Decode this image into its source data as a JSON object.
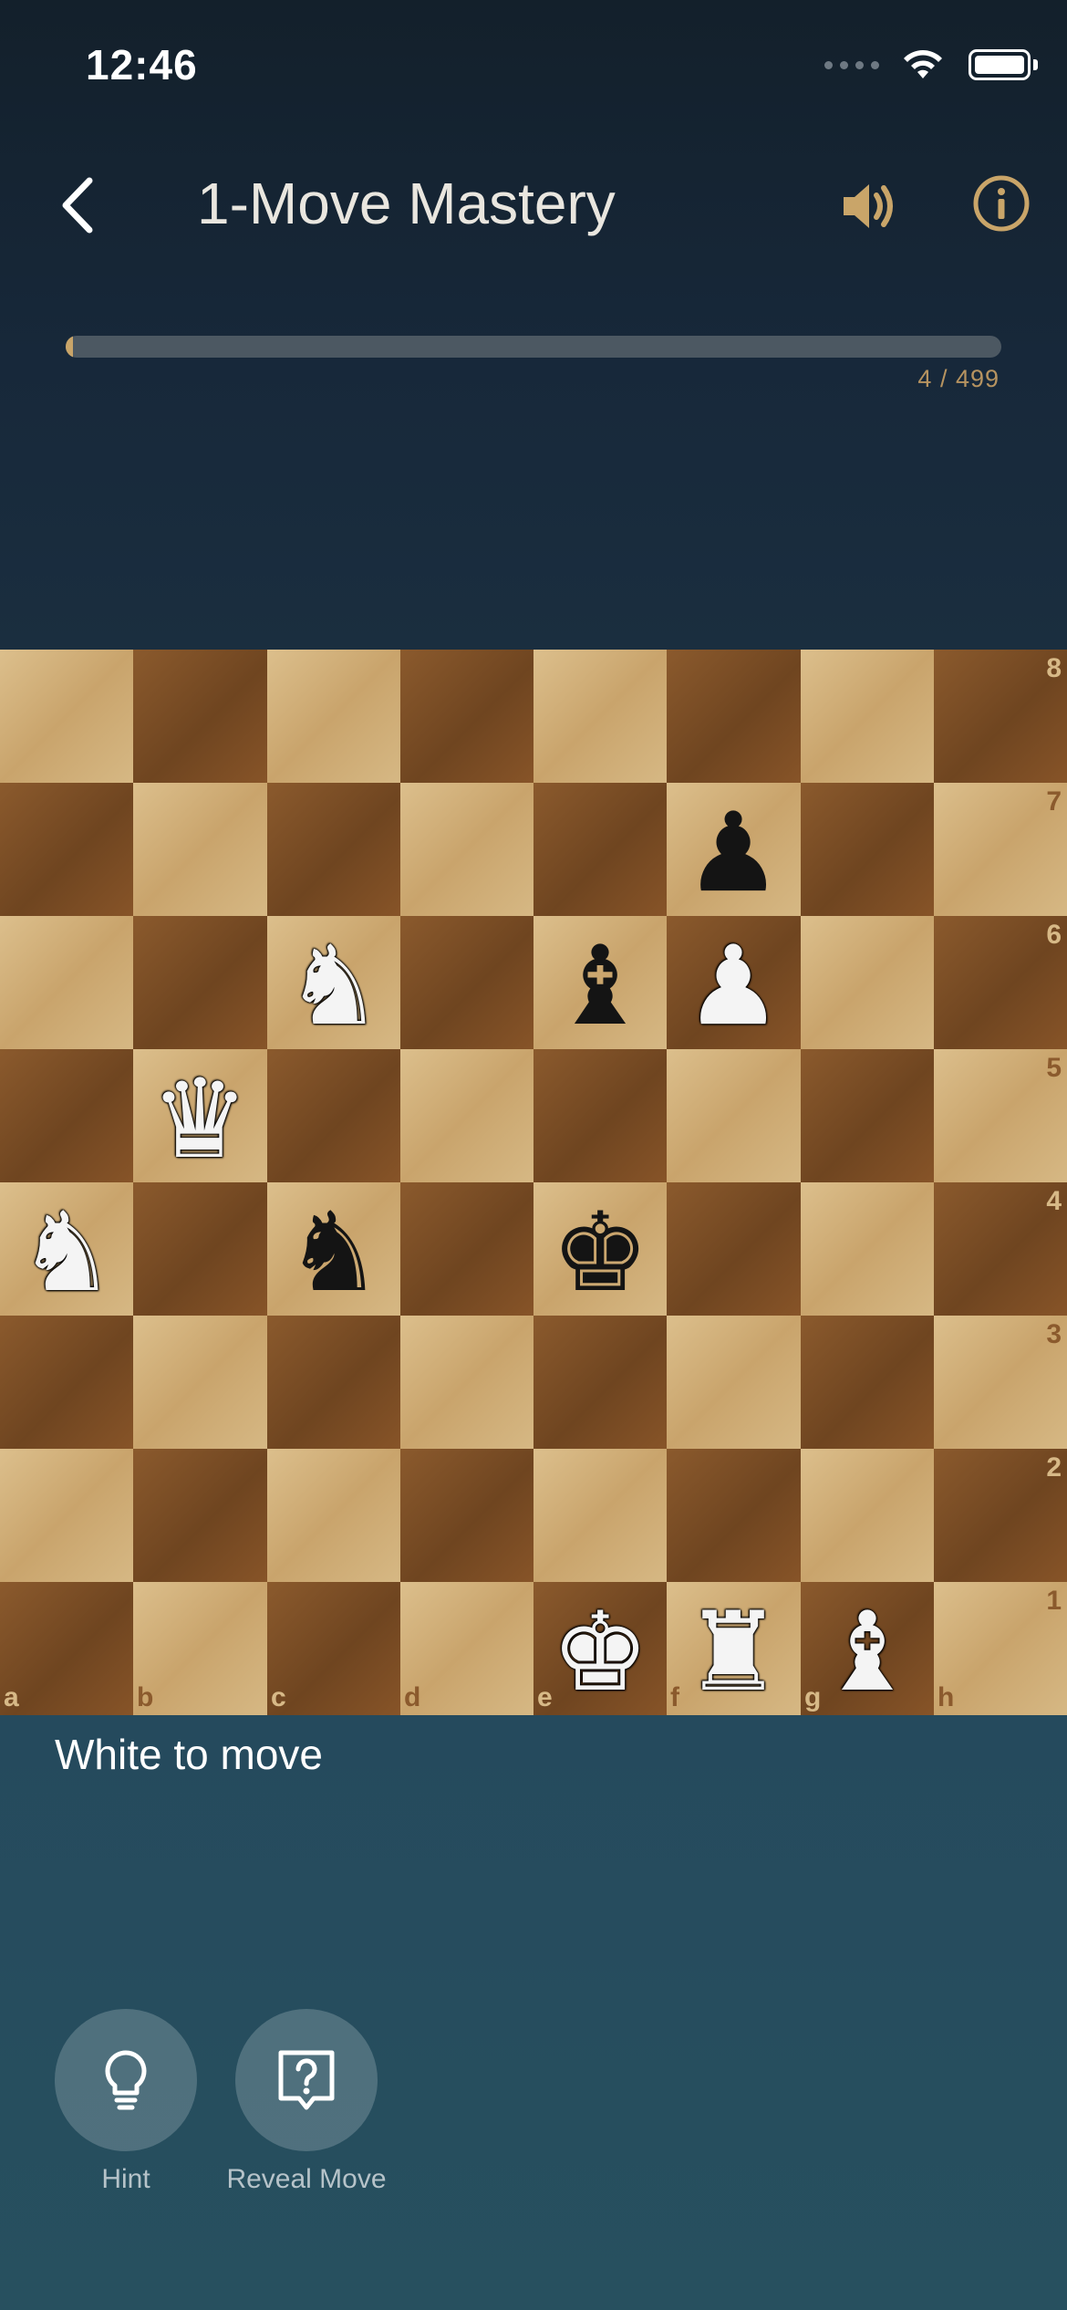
{
  "status_bar": {
    "time": "12:46",
    "icons": [
      "cellular-signal-icon",
      "wifi-icon",
      "battery-icon"
    ]
  },
  "nav": {
    "back_icon": "chevron-left-icon",
    "title": "1-Move Mastery",
    "sound_icon": "speaker-icon",
    "info_icon": "info-icon"
  },
  "progress": {
    "current": 4,
    "total": 499,
    "fraction": 0.008,
    "label": "4 / 499"
  },
  "board": {
    "files": [
      "a",
      "b",
      "c",
      "d",
      "e",
      "f",
      "g",
      "h"
    ],
    "ranks": [
      "8",
      "7",
      "6",
      "5",
      "4",
      "3",
      "2",
      "1"
    ],
    "pieces": [
      {
        "square": "f7",
        "color": "black",
        "type": "pawn",
        "glyph": "♟"
      },
      {
        "square": "c6",
        "color": "white",
        "type": "knight",
        "glyph": "♞"
      },
      {
        "square": "e6",
        "color": "black",
        "type": "bishop",
        "glyph": "♝"
      },
      {
        "square": "f6",
        "color": "white",
        "type": "pawn",
        "glyph": "♟"
      },
      {
        "square": "b5",
        "color": "white",
        "type": "queen",
        "glyph": "♛"
      },
      {
        "square": "a4",
        "color": "white",
        "type": "knight",
        "glyph": "♞"
      },
      {
        "square": "c4",
        "color": "black",
        "type": "knight",
        "glyph": "♞"
      },
      {
        "square": "e4",
        "color": "black",
        "type": "king",
        "glyph": "♚"
      },
      {
        "square": "e1",
        "color": "white",
        "type": "king",
        "glyph": "♚"
      },
      {
        "square": "f1",
        "color": "white",
        "type": "rook",
        "glyph": "♜"
      },
      {
        "square": "g1",
        "color": "white",
        "type": "bishop",
        "glyph": "♝"
      }
    ],
    "colors": {
      "light": "#d4b27c",
      "dark": "#7a4c23"
    }
  },
  "status_message": "White to move",
  "actions": {
    "hint": {
      "label": "Hint",
      "icon": "lightbulb-icon"
    },
    "reveal": {
      "label": "Reveal Move",
      "icon": "question-bubble-icon"
    }
  },
  "colors": {
    "accent": "#c9a569",
    "header_bg": "#162433",
    "footer_bg": "#27505f"
  }
}
